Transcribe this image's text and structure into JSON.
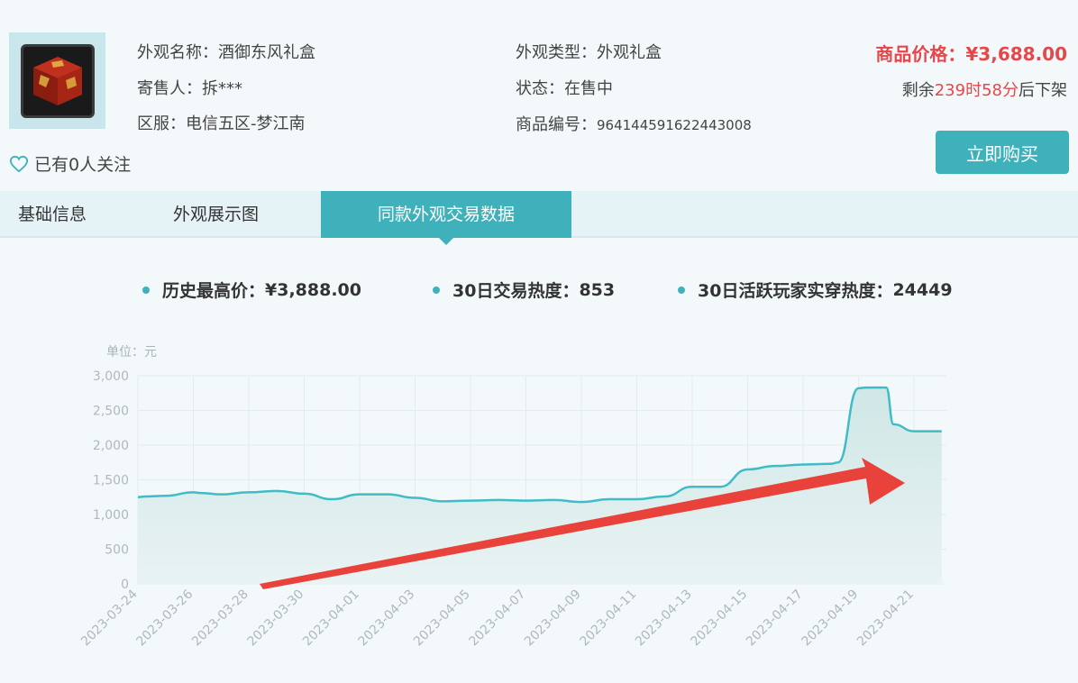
{
  "item": {
    "name_label": "外观名称：",
    "name": "酒御东风礼盒",
    "seller_label": "寄售人：",
    "seller": "拆***",
    "server_label": "区服：",
    "server": "电信五区-梦江南",
    "type_label": "外观类型：",
    "type": "外观礼盒",
    "status_label": "状态：",
    "status": "在售中",
    "id_label": "商品编号：",
    "id": "964144591622443008",
    "follow_text": "已有0人关注"
  },
  "price": {
    "label": "商品价格：",
    "value": "¥3,688.00",
    "remain_prefix": "剩余",
    "hours": "239",
    "hours_unit": "时",
    "minutes": "58",
    "minutes_unit": "分",
    "remain_suffix": "后下架"
  },
  "buy_label": "立即购买",
  "tabs": [
    "基础信息",
    "外观展示图",
    "同款外观交易数据"
  ],
  "stats": {
    "max_label": "历史最高价：",
    "max_value": "¥3,888.00",
    "heat_label": "30日交易热度：",
    "heat_value": "853",
    "active_label": "30日活跃玩家实穿热度：",
    "active_value": "24449"
  },
  "colors": {
    "accent": "#3fb1bb",
    "price": "#e5474b",
    "arrow": "#e8332b"
  },
  "chart_data": {
    "type": "area",
    "unit_label": "单位：元",
    "ylim": [
      0,
      3000
    ],
    "yticks": [
      "0",
      "500",
      "1,000",
      "1,500",
      "2,000",
      "2,500",
      "3,000"
    ],
    "x_tick_labels": [
      "2023-03-24",
      "2023-03-26",
      "2023-03-28",
      "2023-03-30",
      "2023-04-01",
      "2023-04-03",
      "2023-04-05",
      "2023-04-07",
      "2023-04-09",
      "2023-04-11",
      "2023-04-13",
      "2023-04-15",
      "2023-04-17",
      "2023-04-19",
      "2023-04-21"
    ],
    "x": [
      "2023-03-24",
      "2023-03-24",
      "2023-03-25",
      "2023-03-26",
      "2023-03-26",
      "2023-03-27",
      "2023-03-28",
      "2023-03-29",
      "2023-03-30",
      "2023-03-31",
      "2023-04-01",
      "2023-04-02",
      "2023-04-03",
      "2023-04-04",
      "2023-04-05",
      "2023-04-06",
      "2023-04-07",
      "2023-04-08",
      "2023-04-09",
      "2023-04-10",
      "2023-04-11",
      "2023-04-12",
      "2023-04-13",
      "2023-04-14",
      "2023-04-15",
      "2023-04-16",
      "2023-04-17",
      "2023-04-18",
      "2023-04-18",
      "2023-04-19",
      "2023-04-19",
      "2023-04-20",
      "2023-04-20",
      "2023-04-21",
      "2023-04-22"
    ],
    "y": [
      1250,
      1260,
      1270,
      1320,
      1310,
      1290,
      1320,
      1340,
      1300,
      1220,
      1290,
      1290,
      1240,
      1190,
      1200,
      1210,
      1200,
      1210,
      1180,
      1220,
      1220,
      1260,
      1400,
      1400,
      1650,
      1700,
      1720,
      1730,
      1750,
      2820,
      2830,
      2830,
      2300,
      2200,
      2200
    ],
    "grid": true,
    "legend": "none"
  }
}
